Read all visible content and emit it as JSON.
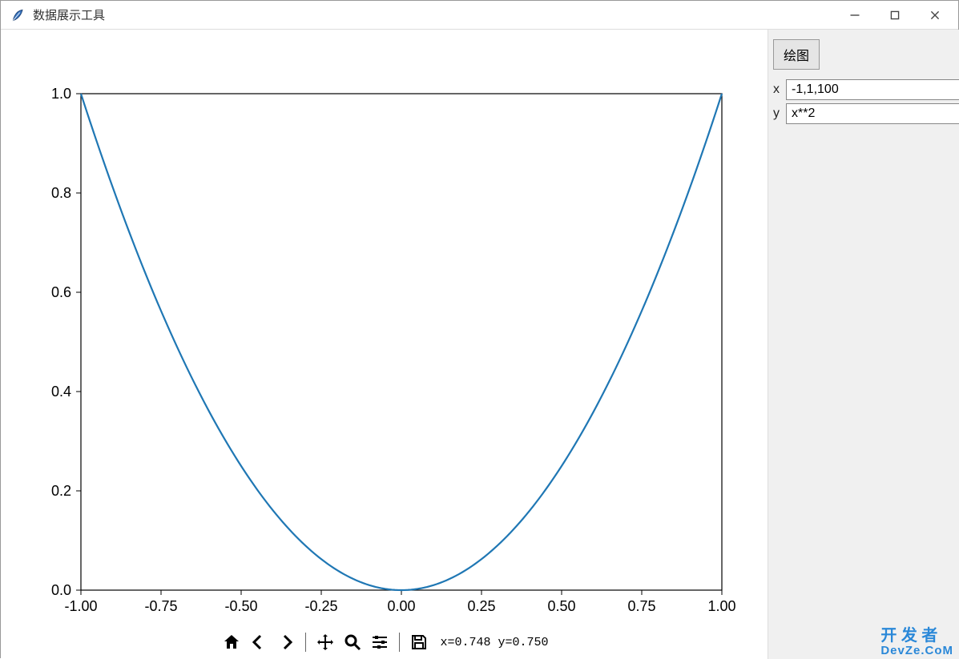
{
  "window": {
    "title": "数据展示工具"
  },
  "side": {
    "plot_button": "绘图",
    "x_label": "x",
    "x_value": "-1,1,100",
    "y_label": "y",
    "y_value": "x**2"
  },
  "toolbar": {
    "coords": "x=0.748 y=0.750",
    "icons": {
      "home": "home-icon",
      "back": "arrow-left-icon",
      "forward": "arrow-right-icon",
      "pan": "move-icon",
      "zoom": "zoom-icon",
      "configure": "sliders-icon",
      "save": "save-icon"
    }
  },
  "watermark": {
    "line1": "开 发 者",
    "line2": "DevZe.CoM"
  },
  "chart_data": {
    "type": "line",
    "title": "",
    "xlabel": "",
    "ylabel": "",
    "xlim": [
      -1.0,
      1.0
    ],
    "ylim": [
      0.0,
      1.0
    ],
    "xticks": [
      -1.0,
      -0.75,
      -0.5,
      -0.25,
      0.0,
      0.25,
      0.5,
      0.75,
      1.0
    ],
    "yticks": [
      0.0,
      0.2,
      0.4,
      0.6,
      0.8,
      1.0
    ],
    "series": [
      {
        "name": "y = x**2",
        "color": "#1f77b4",
        "x": [
          -1.0,
          -0.9,
          -0.8,
          -0.7,
          -0.6,
          -0.5,
          -0.4,
          -0.3,
          -0.2,
          -0.1,
          0.0,
          0.1,
          0.2,
          0.3,
          0.4,
          0.5,
          0.6,
          0.7,
          0.8,
          0.9,
          1.0
        ],
        "y": [
          1.0,
          0.81,
          0.64,
          0.49,
          0.36,
          0.25,
          0.16,
          0.09,
          0.04,
          0.01,
          0.0,
          0.01,
          0.04,
          0.09,
          0.16,
          0.25,
          0.36,
          0.49,
          0.64,
          0.81,
          1.0
        ]
      }
    ]
  }
}
